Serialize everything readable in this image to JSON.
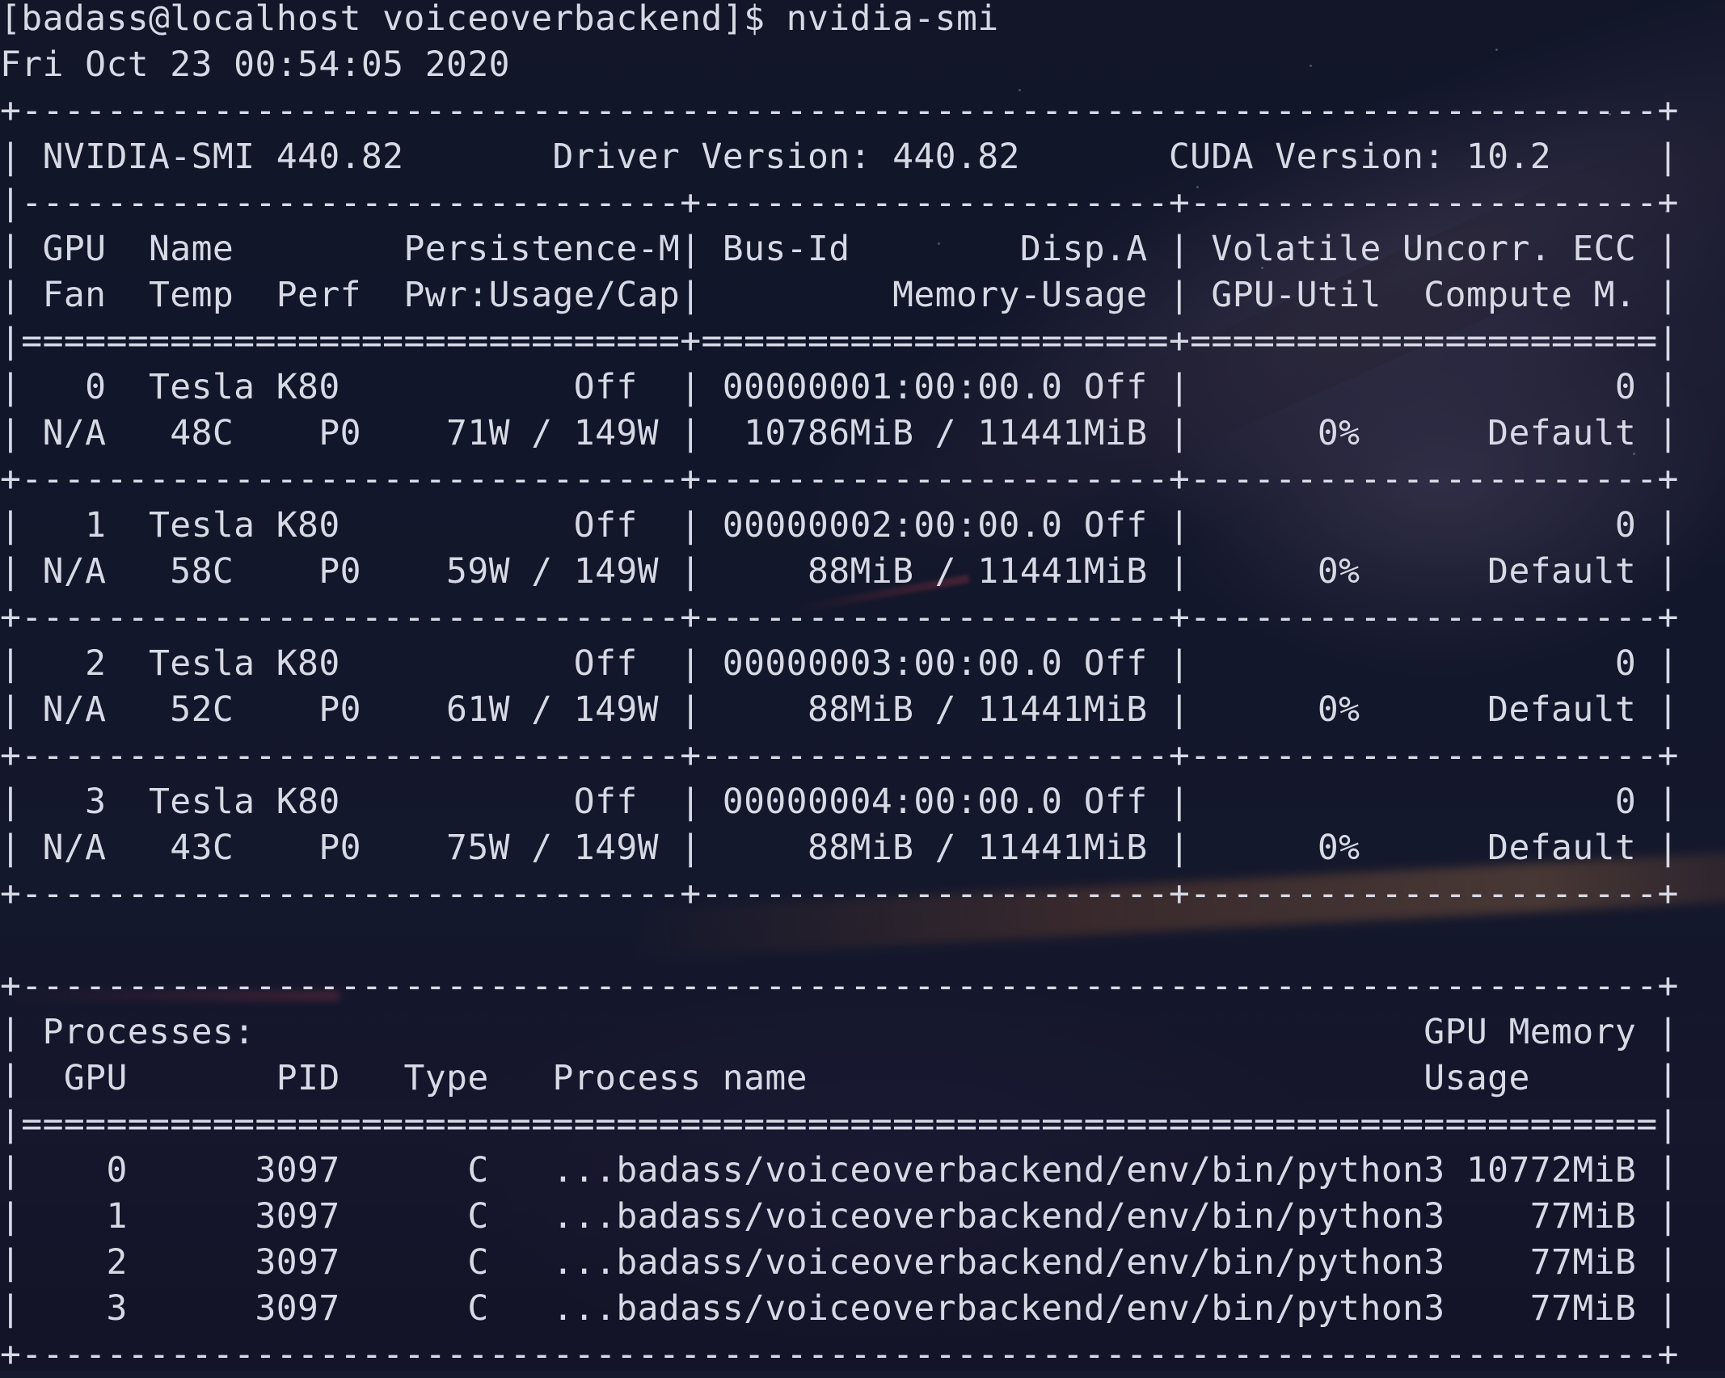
{
  "terminal": {
    "lines": [
      "[badass@localhost voiceoverbackend]$ nvidia-smi",
      "Fri Oct 23 00:54:05 2020",
      "+-----------------------------------------------------------------------------+",
      "| NVIDIA-SMI 440.82       Driver Version: 440.82       CUDA Version: 10.2     |",
      "|-------------------------------+----------------------+----------------------+",
      "| GPU  Name        Persistence-M| Bus-Id        Disp.A | Volatile Uncorr. ECC |",
      "| Fan  Temp  Perf  Pwr:Usage/Cap|         Memory-Usage | GPU-Util  Compute M. |",
      "|===============================+======================+======================|",
      "|   0  Tesla K80           Off  | 00000001:00:00.0 Off |                    0 |",
      "| N/A   48C    P0    71W / 149W |  10786MiB / 11441MiB |      0%      Default |",
      "+-------------------------------+----------------------+----------------------+",
      "|   1  Tesla K80           Off  | 00000002:00:00.0 Off |                    0 |",
      "| N/A   58C    P0    59W / 149W |     88MiB / 11441MiB |      0%      Default |",
      "+-------------------------------+----------------------+----------------------+",
      "|   2  Tesla K80           Off  | 00000003:00:00.0 Off |                    0 |",
      "| N/A   52C    P0    61W / 149W |     88MiB / 11441MiB |      0%      Default |",
      "+-------------------------------+----------------------+----------------------+",
      "|   3  Tesla K80           Off  | 00000004:00:00.0 Off |                    0 |",
      "| N/A   43C    P0    75W / 149W |     88MiB / 11441MiB |      0%      Default |",
      "+-------------------------------+----------------------+----------------------+",
      "",
      "+-----------------------------------------------------------------------------+",
      "| Processes:                                                       GPU Memory |",
      "|  GPU       PID   Type   Process name                             Usage      |",
      "|=============================================================================|",
      "|    0      3097      C   ...badass/voiceoverbackend/env/bin/python3 10772MiB |",
      "|    1      3097      C   ...badass/voiceoverbackend/env/bin/python3    77MiB |",
      "|    2      3097      C   ...badass/voiceoverbackend/env/bin/python3    77MiB |",
      "|    3      3097      C   ...badass/voiceoverbackend/env/bin/python3    77MiB |",
      "+-----------------------------------------------------------------------------+"
    ]
  }
}
